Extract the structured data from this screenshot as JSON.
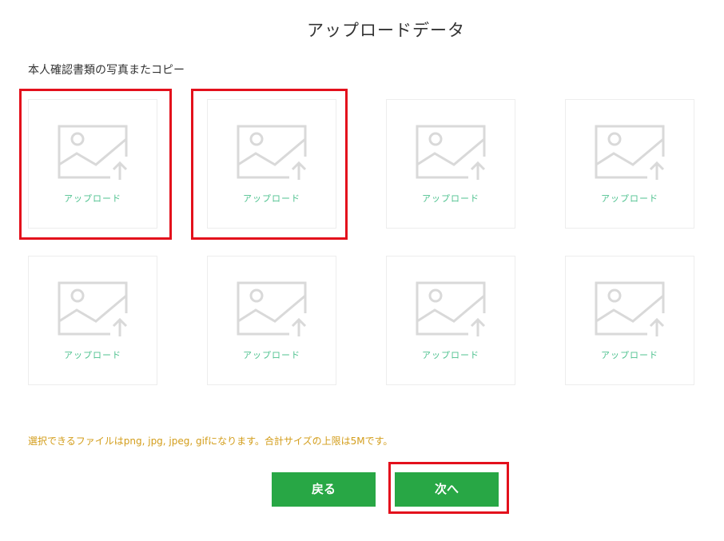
{
  "header": {
    "title": "アップロードデータ"
  },
  "section": {
    "label": "本人確認書類の写真またコピー"
  },
  "uploads": [
    {
      "label": "アップロード"
    },
    {
      "label": "アップロード"
    },
    {
      "label": "アップロード"
    },
    {
      "label": "アップロード"
    },
    {
      "label": "アップロード"
    },
    {
      "label": "アップロード"
    },
    {
      "label": "アップロード"
    },
    {
      "label": "アップロード"
    }
  ],
  "notice": {
    "text": "選択できるファイルはpng, jpg, jpeg, gifになります。合計サイズの上限は5Mです。"
  },
  "actions": {
    "back_label": "戻る",
    "next_label": "次へ"
  },
  "colors": {
    "accent_green": "#28a745",
    "upload_text": "#4fc28f",
    "notice_text": "#d39d1a",
    "highlight_red": "#e3101c",
    "placeholder_icon": "#d9d9d9"
  },
  "icons": {
    "tile_icon": "image-upload-icon"
  }
}
